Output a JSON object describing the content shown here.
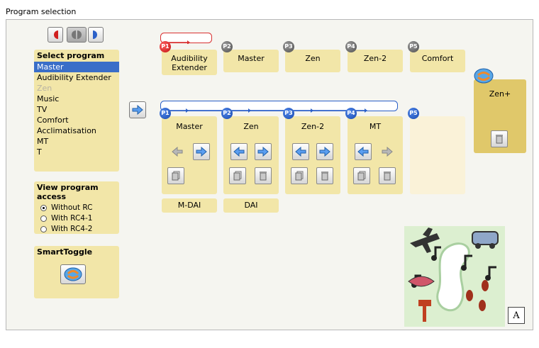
{
  "window": {
    "title": "Program selection"
  },
  "select_program": {
    "title": "Select program",
    "items": [
      {
        "label": "Master",
        "state": "selected"
      },
      {
        "label": "Audibility Extender",
        "state": "normal"
      },
      {
        "label": "Zen",
        "state": "disabled"
      },
      {
        "label": "Music",
        "state": "normal"
      },
      {
        "label": "TV",
        "state": "normal"
      },
      {
        "label": "Comfort",
        "state": "normal"
      },
      {
        "label": "Acclimatisation",
        "state": "normal"
      },
      {
        "label": "MT",
        "state": "normal"
      },
      {
        "label": "T",
        "state": "normal"
      }
    ]
  },
  "view_access": {
    "title": "View program access",
    "options": [
      {
        "label": "Without RC",
        "checked": true
      },
      {
        "label": "With RC4-1",
        "checked": false
      },
      {
        "label": "With RC4-2",
        "checked": false
      }
    ]
  },
  "smarttoggle": {
    "title": "SmartToggle"
  },
  "top_programs": [
    {
      "badge": "P1",
      "label_line1": "Audibility",
      "label_line2": "Extender"
    },
    {
      "badge": "P2",
      "label_line1": "Master",
      "label_line2": ""
    },
    {
      "badge": "P3",
      "label_line1": "Zen",
      "label_line2": ""
    },
    {
      "badge": "P4",
      "label_line1": "Zen-2",
      "label_line2": ""
    },
    {
      "badge": "P5",
      "label_line1": "Comfort",
      "label_line2": ""
    }
  ],
  "bottom_programs": [
    {
      "badge": "P1",
      "label": "Master"
    },
    {
      "badge": "P2",
      "label": "Zen"
    },
    {
      "badge": "P3",
      "label": "Zen-2"
    },
    {
      "badge": "P4",
      "label": "MT"
    },
    {
      "badge": "P5",
      "label": ""
    }
  ],
  "tags": [
    "M-DAI",
    "DAI"
  ],
  "zen_plus": {
    "label": "Zen+"
  },
  "font_button": {
    "label": "A"
  },
  "colors": {
    "panel": "#f2e6a8",
    "selection": "#3a6ec8",
    "accent_blue": "#3a7bd5",
    "timeline_red": "#d83030"
  }
}
